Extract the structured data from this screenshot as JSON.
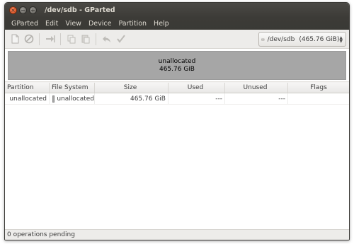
{
  "window": {
    "title": "/dev/sdb - GParted"
  },
  "window_buttons": {
    "close": "×",
    "minimize": "−",
    "maximize": "+"
  },
  "menubar": {
    "items": [
      "GParted",
      "Edit",
      "View",
      "Device",
      "Partition",
      "Help"
    ]
  },
  "toolbar": {
    "device": {
      "name": "/dev/sdb",
      "size": "(465.76 GiB)"
    }
  },
  "graphic": {
    "label": "unallocated",
    "size": "465.76 GiB"
  },
  "table": {
    "headers": [
      "Partition",
      "File System",
      "Size",
      "Used",
      "Unused",
      "Flags"
    ],
    "rows": [
      {
        "partition": "unallocated",
        "filesystem": "unallocated",
        "size": "465.76 GiB",
        "used": "---",
        "unused": "---",
        "flags": ""
      }
    ]
  },
  "status": {
    "text": "0 operations pending"
  },
  "colors": {
    "unallocated": "#a6a6a6",
    "titlebar": "#3c3b37",
    "close_button": "#e2572a"
  }
}
